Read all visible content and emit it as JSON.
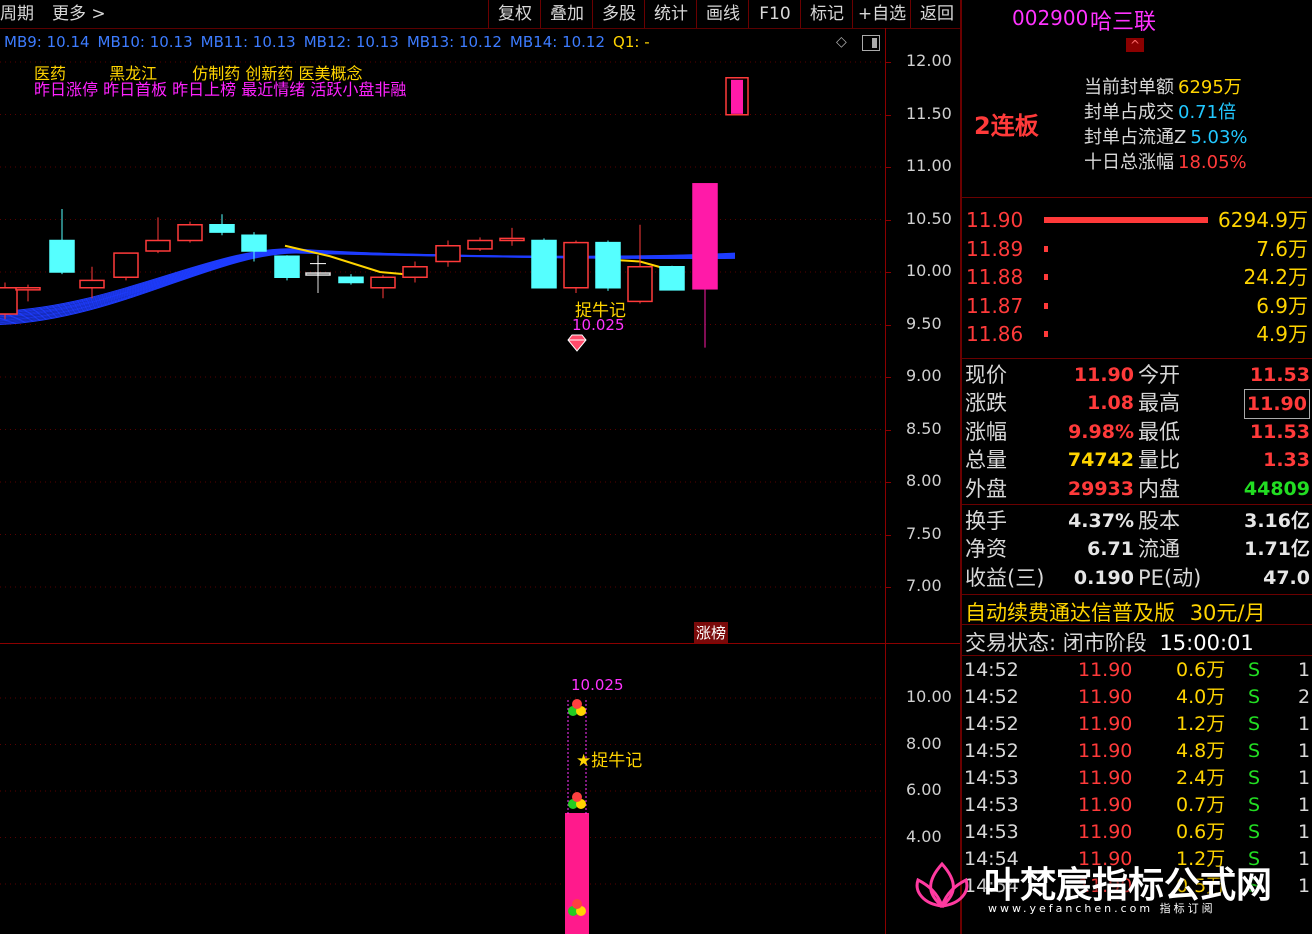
{
  "toolbar": {
    "period_label": "周期",
    "more_label": "更多 >",
    "buttons": [
      "复权",
      "叠加",
      "多股",
      "统计",
      "画线",
      "F10",
      "标记",
      "+自选",
      "返回"
    ]
  },
  "ma_line": {
    "items": [
      "MB9: 10.14",
      "MB10: 10.13",
      "MB11: 10.13",
      "MB12: 10.13",
      "MB13: 10.12",
      "MB14: 10.12"
    ],
    "q1": "Q1: -"
  },
  "tags": {
    "row1": [
      "医药",
      "黑龙江",
      "仿制药",
      "创新药",
      "医美概念"
    ],
    "row2": "昨日涨停 昨日首板 昨日上榜 最近情绪 活跃小盘非融"
  },
  "main_chart": {
    "price_axis": [
      "12.00",
      "11.50",
      "11.00",
      "10.50",
      "10.00",
      "9.50",
      "9.00",
      "8.50",
      "8.00",
      "7.50",
      "7.00"
    ],
    "annotation_label": "捉牛记",
    "annotation_value": "10.025",
    "zhangbang_label": "涨榜"
  },
  "sub_chart": {
    "axis": [
      "10.00",
      "8.00",
      "6.00",
      "4.00"
    ],
    "value_label": "10.025",
    "star_label": "★捉牛记"
  },
  "stock": {
    "code": "002900",
    "name": "哈三联",
    "streak": "2连板",
    "stats": [
      {
        "label": "当前封单额",
        "value": "6295万",
        "color": "#ffd400"
      },
      {
        "label": "封单占成交",
        "value": "0.71倍",
        "color": "#22c8ff"
      },
      {
        "label": "封单占流通Z",
        "value": "5.03%",
        "color": "#22c8ff"
      },
      {
        "label": "十日总涨幅",
        "value": "18.05%",
        "color": "#ff3a3a"
      }
    ]
  },
  "order_book": [
    {
      "price": "11.90",
      "volume": "6294.9万",
      "bar": 1.0
    },
    {
      "price": "11.89",
      "volume": "7.6万",
      "bar": 0.01
    },
    {
      "price": "11.88",
      "volume": "24.2万",
      "bar": 0.01
    },
    {
      "price": "11.87",
      "volume": "6.9万",
      "bar": 0.01
    },
    {
      "price": "11.86",
      "volume": "4.9万",
      "bar": 0.01
    }
  ],
  "quote": [
    {
      "l1": "现价",
      "v1": "11.90",
      "c1": "#ff3a3a",
      "l2": "今开",
      "v2": "11.53",
      "c2": "#ff3a3a"
    },
    {
      "l1": "涨跌",
      "v1": "1.08",
      "c1": "#ff3a3a",
      "l2": "最高",
      "v2": "11.90",
      "c2": "#ff3a3a"
    },
    {
      "l1": "涨幅",
      "v1": "9.98%",
      "c1": "#ff3a3a",
      "l2": "最低",
      "v2": "11.53",
      "c2": "#ff3a3a"
    },
    {
      "l1": "总量",
      "v1": "74742",
      "c1": "#ffd400",
      "l2": "量比",
      "v2": "1.33",
      "c2": "#ff3a3a"
    },
    {
      "l1": "外盘",
      "v1": "29933",
      "c1": "#ff3a3a",
      "l2": "内盘",
      "v2": "44809",
      "c2": "#22dd22"
    }
  ],
  "fundamentals": [
    {
      "l1": "换手",
      "v1": "4.37%",
      "l2": "股本",
      "v2": "3.16亿"
    },
    {
      "l1": "净资",
      "v1": "6.71",
      "l2": "流通",
      "v2": "1.71亿"
    },
    {
      "l1": "收益(三)",
      "v1": "0.190",
      "l2": "PE(动)",
      "v2": "47.0"
    }
  ],
  "promo": {
    "text": "自动续费通达信普及版",
    "price": "30元/月"
  },
  "trade_status": {
    "label": "交易状态: 闭市阶段",
    "time": "15:00:01"
  },
  "ticks": [
    {
      "time": "14:52",
      "price": "11.90",
      "vol": "0.6万",
      "side": "S",
      "n": "1"
    },
    {
      "time": "14:52",
      "price": "11.90",
      "vol": "4.0万",
      "side": "S",
      "n": "2"
    },
    {
      "time": "14:52",
      "price": "11.90",
      "vol": "1.2万",
      "side": "S",
      "n": "1"
    },
    {
      "time": "14:52",
      "price": "11.90",
      "vol": "4.8万",
      "side": "S",
      "n": "1"
    },
    {
      "time": "14:53",
      "price": "11.90",
      "vol": "2.4万",
      "side": "S",
      "n": "1"
    },
    {
      "time": "14:53",
      "price": "11.90",
      "vol": "0.7万",
      "side": "S",
      "n": "1"
    },
    {
      "time": "14:53",
      "price": "11.90",
      "vol": "0.6万",
      "side": "S",
      "n": "1"
    },
    {
      "time": "14:54",
      "price": "11.90",
      "vol": "1.2万",
      "side": "S",
      "n": "1"
    },
    {
      "time": "14:54",
      "price": "11.90",
      "vol": "0.5万",
      "side": "S",
      "n": "1"
    }
  ],
  "watermark": {
    "title": "叶梵宸指标公式网",
    "url": "www.yefanchen.com  指标订阅"
  }
}
